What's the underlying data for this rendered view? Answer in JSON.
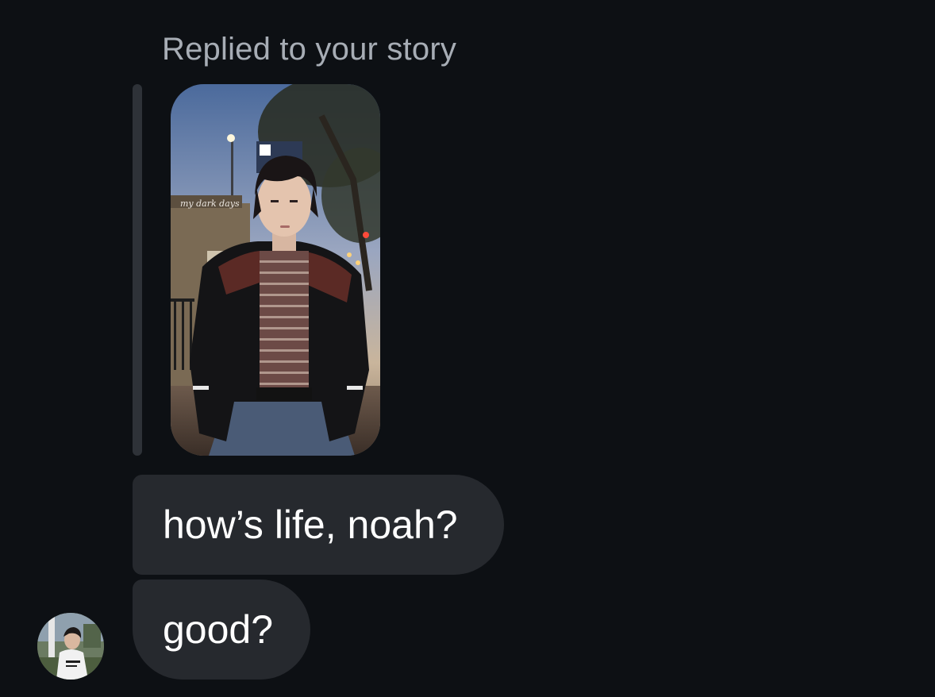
{
  "header": {
    "reply_label": "Replied to your story"
  },
  "story": {
    "caption": "my dark days",
    "image_icon": "story-photo"
  },
  "messages": [
    {
      "text": "how’s life, noah?"
    },
    {
      "text": "good?"
    }
  ],
  "sender": {
    "avatar_icon": "profile-avatar"
  },
  "colors": {
    "background": "#0d1014",
    "bubble": "#26292e",
    "label": "#a7adb5",
    "quote_bar": "#2e3238"
  }
}
